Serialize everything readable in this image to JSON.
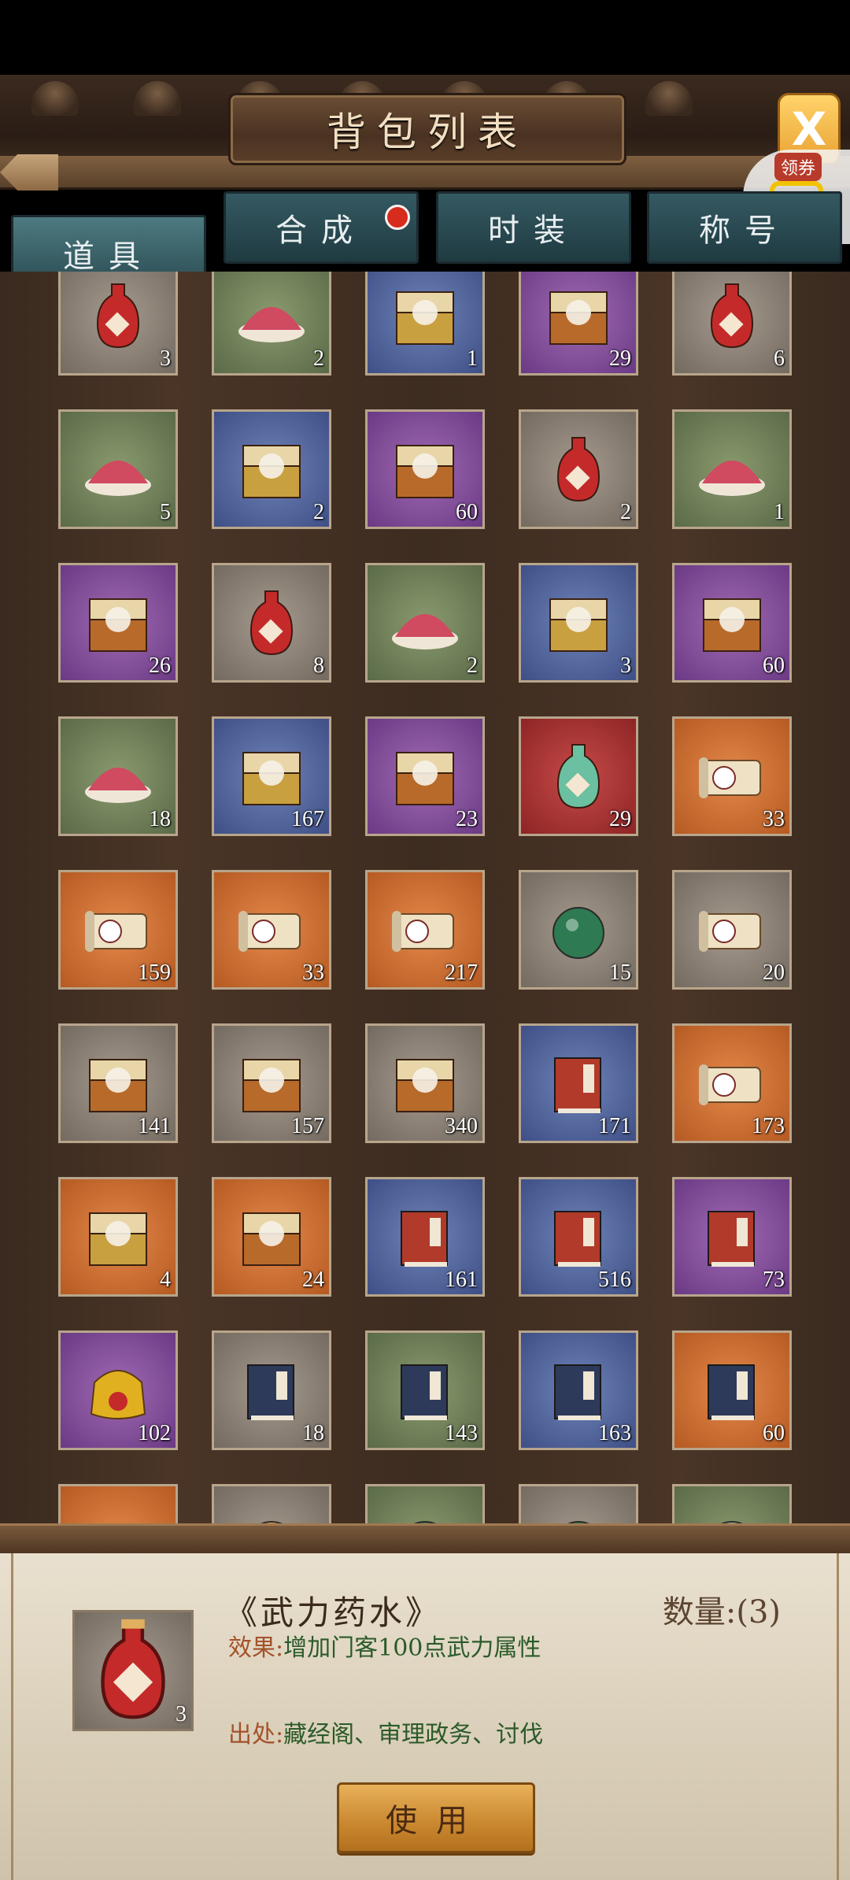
{
  "header": {
    "title": "背包列表"
  },
  "close_button": {
    "label": "X"
  },
  "coupon": {
    "tag": "领券"
  },
  "tabs": [
    {
      "label": "道具",
      "active": true
    },
    {
      "label": "合成",
      "active": false,
      "badge": true
    },
    {
      "label": "时装",
      "active": false
    },
    {
      "label": "称号",
      "active": false
    }
  ],
  "items": [
    {
      "icon": "red-potion-wu-icon",
      "bg": "gray",
      "count": "3"
    },
    {
      "icon": "red-powder-icon",
      "bg": "green",
      "count": "2"
    },
    {
      "icon": "red-orb-box-icon",
      "bg": "blue",
      "count": "1"
    },
    {
      "icon": "red-orb-chest-icon",
      "bg": "purple",
      "count": "29"
    },
    {
      "icon": "blue-potion-zhi-icon",
      "bg": "gray",
      "count": "6"
    },
    {
      "icon": "blue-powder-icon",
      "bg": "green",
      "count": "5"
    },
    {
      "icon": "blue-orb-box-icon",
      "bg": "blue",
      "count": "2"
    },
    {
      "icon": "blue-orb-chest-icon",
      "bg": "purple",
      "count": "60"
    },
    {
      "icon": "orange-potion-zheng-icon",
      "bg": "gray",
      "count": "2"
    },
    {
      "icon": "orange-powder-icon",
      "bg": "green",
      "count": "1"
    },
    {
      "icon": "orange-orb-chest-icon",
      "bg": "purple",
      "count": "26"
    },
    {
      "icon": "purple-potion-mei-icon",
      "bg": "gray",
      "count": "8"
    },
    {
      "icon": "purple-powder-icon",
      "bg": "green",
      "count": "2"
    },
    {
      "icon": "purple-orb-box-icon",
      "bg": "blue",
      "count": "3"
    },
    {
      "icon": "purple-orb-chest-icon",
      "bg": "purple",
      "count": "60"
    },
    {
      "icon": "rainbow-powder-icon",
      "bg": "green",
      "count": "18"
    },
    {
      "icon": "rainbow-orb-box-icon",
      "bg": "blue",
      "count": "167"
    },
    {
      "icon": "rainbow-orb-chest-icon",
      "bg": "purple",
      "count": "23"
    },
    {
      "icon": "rainbow-gourd-icon",
      "bg": "red",
      "count": "29"
    },
    {
      "icon": "scroll-you-icon",
      "bg": "orange",
      "count": "33"
    },
    {
      "icon": "scroll-zhi-icon",
      "bg": "orange",
      "count": "159"
    },
    {
      "icon": "scroll-zheng-icon",
      "bg": "orange",
      "count": "33"
    },
    {
      "icon": "scroll-mei-icon",
      "bg": "orange",
      "count": "217"
    },
    {
      "icon": "jade-beast-icon",
      "bg": "gray",
      "count": "15"
    },
    {
      "icon": "blue-scroll-liang-icon",
      "bg": "gray",
      "count": "20"
    },
    {
      "icon": "gold-orb-chest-icon",
      "bg": "gray",
      "count": "141"
    },
    {
      "icon": "red-orb-chest-icon",
      "bg": "gray",
      "count": "157"
    },
    {
      "icon": "green-orb-chest-icon",
      "bg": "gray",
      "count": "340"
    },
    {
      "icon": "red-book-icon",
      "bg": "blue",
      "count": "171"
    },
    {
      "icon": "scroll-bag-icon",
      "bg": "orange",
      "count": "173"
    },
    {
      "icon": "red-book-box-icon",
      "bg": "orange",
      "count": "4"
    },
    {
      "icon": "treasure-chest-icon",
      "bg": "orange",
      "count": "24"
    },
    {
      "icon": "skill-book-icon",
      "bg": "blue",
      "count": "161"
    },
    {
      "icon": "exp-book-icon",
      "bg": "blue",
      "count": "516"
    },
    {
      "icon": "gold-bundle-book-icon",
      "bg": "purple",
      "count": "73"
    },
    {
      "icon": "gold-bundle-icon",
      "bg": "purple",
      "count": "102"
    },
    {
      "icon": "navy-manual-icon",
      "bg": "gray",
      "count": "18"
    },
    {
      "icon": "green-manual-icon",
      "bg": "green",
      "count": "143"
    },
    {
      "icon": "red-manual-icon",
      "bg": "blue",
      "count": "163"
    },
    {
      "icon": "skill-manual-icon",
      "bg": "orange",
      "count": "60"
    },
    {
      "icon": "scroll-partial-icon",
      "bg": "orange",
      "count": ""
    },
    {
      "icon": "orange-pendant-icon",
      "bg": "gray",
      "count": ""
    },
    {
      "icon": "jade-pendant-icon",
      "bg": "green",
      "count": ""
    },
    {
      "icon": "jade-carving-icon",
      "bg": "gray",
      "count": ""
    },
    {
      "icon": "blue-carving-icon",
      "bg": "green",
      "count": ""
    }
  ],
  "detail": {
    "name": "《武力药水》",
    "quantity": "数量:(3)",
    "icon_count": "3",
    "effect_label": "效果:",
    "effect_text": "增加门客100点武力属性",
    "source_label": "出处:",
    "source_text": "藏经阁、审理政务、讨伐",
    "use_button": "使用"
  }
}
